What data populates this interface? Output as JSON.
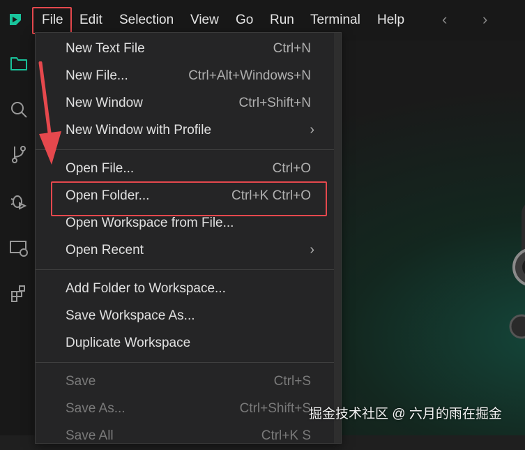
{
  "menubar": {
    "items": [
      "File",
      "Edit",
      "Selection",
      "View",
      "Go",
      "Run",
      "Terminal",
      "Help"
    ],
    "back_icon": "chevron-left-icon",
    "forward_icon": "chevron-right-icon"
  },
  "activitybar": {
    "icons": [
      "explorer-icon",
      "search-icon",
      "source-control-icon",
      "run-debug-icon",
      "remote-explorer-icon",
      "extensions-icon"
    ]
  },
  "file_menu": {
    "items": [
      {
        "label": "New Text File",
        "shortcut": "Ctrl+N"
      },
      {
        "label": "New File...",
        "shortcut": "Ctrl+Alt+Windows+N"
      },
      {
        "label": "New Window",
        "shortcut": "Ctrl+Shift+N"
      },
      {
        "label": "New Window with Profile",
        "shortcut": ""
      },
      {
        "label": "Open File...",
        "shortcut": "Ctrl+O"
      },
      {
        "label": "Open Folder...",
        "shortcut": "Ctrl+K Ctrl+O"
      },
      {
        "label": "Open Workspace from File...",
        "shortcut": ""
      },
      {
        "label": "Open Recent",
        "shortcut": ""
      },
      {
        "label": "Add Folder to Workspace...",
        "shortcut": ""
      },
      {
        "label": "Save Workspace As...",
        "shortcut": ""
      },
      {
        "label": "Duplicate Workspace",
        "shortcut": ""
      },
      {
        "label": "Save",
        "shortcut": "Ctrl+S"
      },
      {
        "label": "Save As...",
        "shortcut": "Ctrl+Shift+S"
      },
      {
        "label": "Save All",
        "shortcut": "Ctrl+K S"
      }
    ]
  },
  "watermark": "掘金技术社区 @ 六月的雨在掘金",
  "colors": {
    "highlight": "#e5484d",
    "accent": "#10b981"
  }
}
